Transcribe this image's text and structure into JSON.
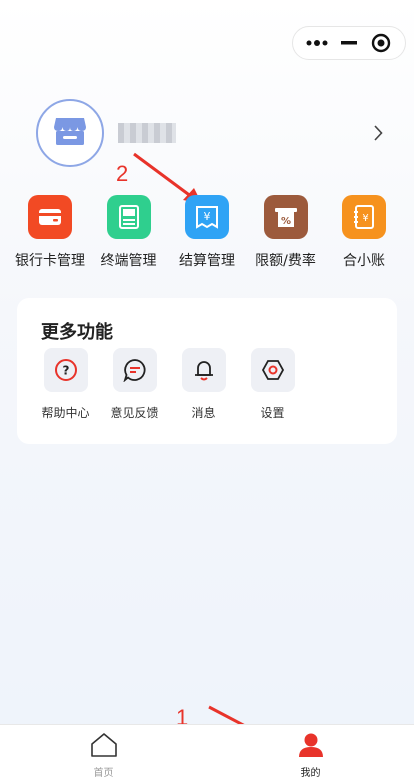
{
  "capsule": {
    "more_icon": "more-dots-icon",
    "minimize_icon": "minimize-icon",
    "close_icon": "target-close-icon"
  },
  "profile": {
    "avatar_icon": "store-icon",
    "username": ""
  },
  "annotations": {
    "step1": "1",
    "step2": "2"
  },
  "quick_actions": [
    {
      "label": "银行卡管理",
      "icon": "bank-card-icon",
      "color": "#f24a24"
    },
    {
      "label": "终端管理",
      "icon": "terminal-icon",
      "color": "#2fcf8e"
    },
    {
      "label": "结算管理",
      "icon": "settlement-yen-icon",
      "color": "#2fa3f5"
    },
    {
      "label": "限额/费率",
      "icon": "rate-percent-icon",
      "color": "#9c5a3c"
    },
    {
      "label": "合小账",
      "icon": "ledger-icon",
      "color": "#f6921e"
    }
  ],
  "more": {
    "title": "更多功能",
    "items": [
      {
        "label": "帮助中心",
        "icon": "help-icon"
      },
      {
        "label": "意见反馈",
        "icon": "feedback-icon"
      },
      {
        "label": "消息",
        "icon": "bell-icon"
      },
      {
        "label": "设置",
        "icon": "settings-icon"
      }
    ]
  },
  "tabbar": {
    "tabs": [
      {
        "label": "首页",
        "icon": "home-icon",
        "active": false
      },
      {
        "label": "我的",
        "icon": "user-icon",
        "active": true
      }
    ],
    "active_color": "#e8332a",
    "inactive_color": "#999999"
  }
}
